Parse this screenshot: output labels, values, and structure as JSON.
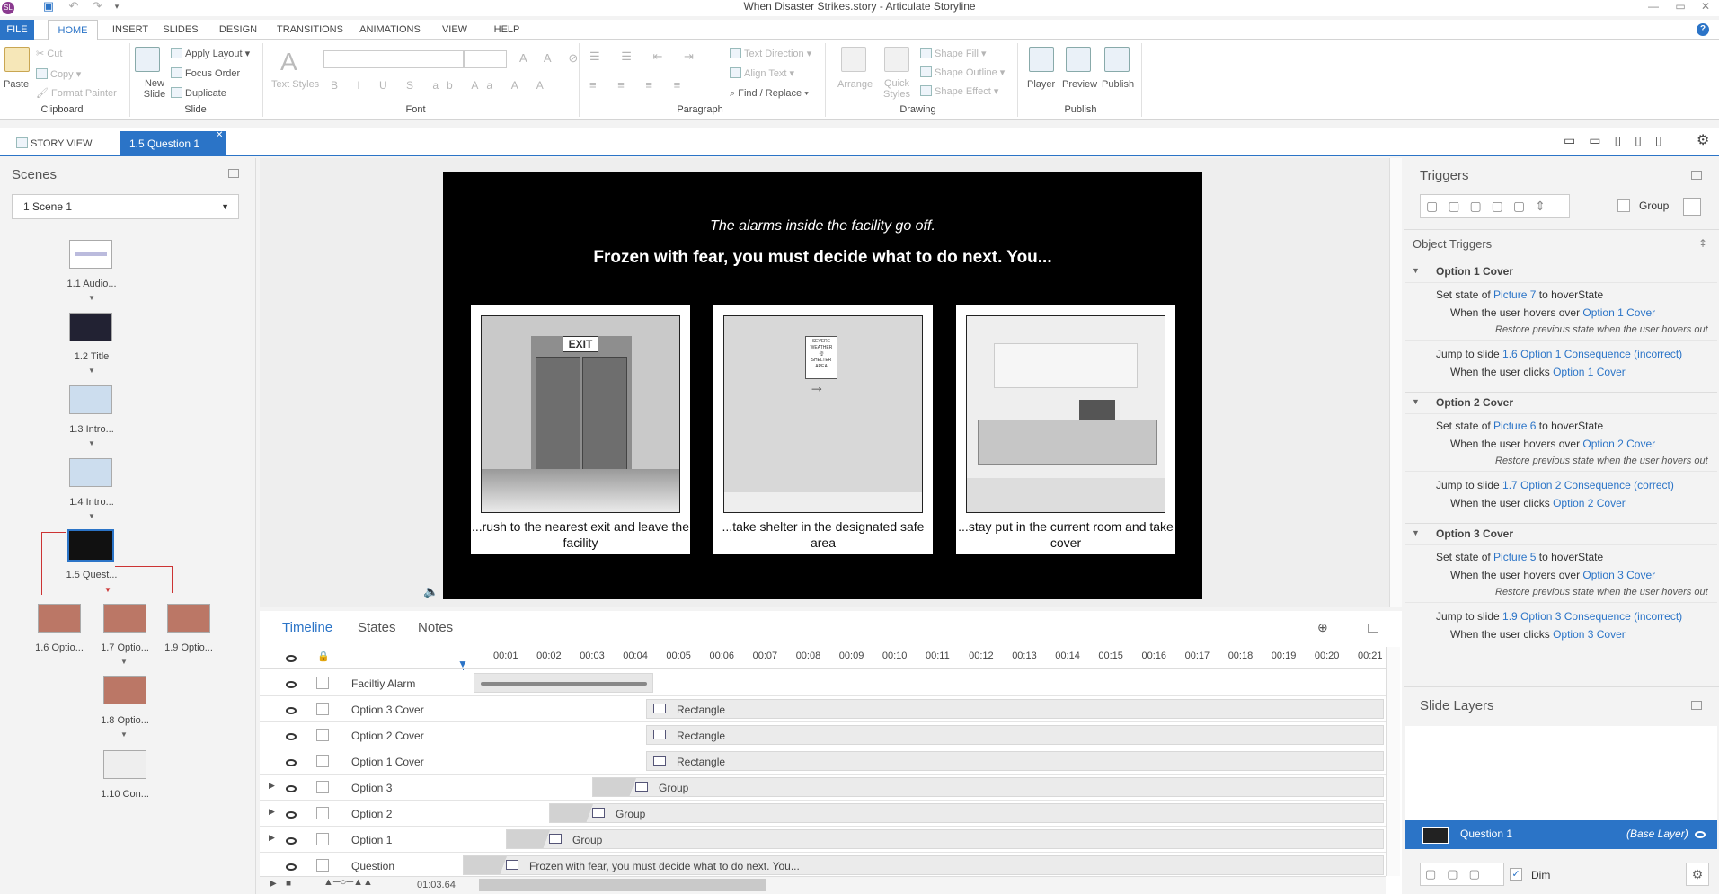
{
  "window": {
    "title": "When Disaster Strikes.story - Articulate Storyline"
  },
  "ribbon_tabs": [
    "FILE",
    "HOME",
    "INSERT",
    "SLIDES",
    "DESIGN",
    "TRANSITIONS",
    "ANIMATIONS",
    "VIEW",
    "HELP"
  ],
  "clipboard": {
    "paste": "Paste",
    "cut": "Cut",
    "copy": "Copy",
    "format_painter": "Format Painter",
    "group": "Clipboard"
  },
  "slide_group": {
    "new_slide": "New Slide",
    "apply_layout": "Apply Layout",
    "focus_order": "Focus Order",
    "duplicate": "Duplicate",
    "group": "Slide"
  },
  "font_group": {
    "text_styles": "Text Styles",
    "group": "Font"
  },
  "paragraph_group": {
    "text_direction": "Text Direction",
    "align_text": "Align Text",
    "find_replace": "Find / Replace",
    "group": "Paragraph"
  },
  "drawing_group": {
    "arrange": "Arrange",
    "quick_styles": "Quick Styles",
    "shape_fill": "Shape Fill",
    "shape_outline": "Shape Outline",
    "shape_effect": "Shape Effect",
    "group": "Drawing"
  },
  "publish_group": {
    "player": "Player",
    "preview": "Preview",
    "publish": "Publish",
    "group": "Publish"
  },
  "doc_tabs": {
    "story_view": "STORY VIEW",
    "active": "1.5 Question 1"
  },
  "scenes": {
    "title": "Scenes",
    "selected": "1 Scene 1",
    "thumbs": [
      "1.1 Audio...",
      "1.2 Title",
      "1.3 Intro...",
      "1.4 Intro...",
      "1.5 Quest...",
      "1.6 Optio...",
      "1.7 Optio...",
      "1.9 Optio...",
      "1.8 Optio...",
      "1.10 Con..."
    ]
  },
  "slide": {
    "subtitle": "The alarms inside the facility go off.",
    "title": "Frozen with fear, you must decide what to do next. You...",
    "options": [
      "...rush to the nearest exit and leave the facility",
      "...take shelter in the designated safe area",
      "...stay put in the current room and take cover"
    ],
    "exit_sign": "EXIT",
    "shelter_sign_top": "SEVERE WEATHER",
    "shelter_sign_bottom": "SHELTER AREA"
  },
  "timeline": {
    "tabs": [
      "Timeline",
      "States",
      "Notes"
    ],
    "ticks": [
      "00:01",
      "00:02",
      "00:03",
      "00:04",
      "00:05",
      "00:06",
      "00:07",
      "00:08",
      "00:09",
      "00:10",
      "00:11",
      "00:12",
      "00:13",
      "00:14",
      "00:15",
      "00:16",
      "00:17",
      "00:18",
      "00:19",
      "00:20",
      "00:21"
    ],
    "rows": [
      {
        "name": "Faciltiy Alarm",
        "bar": ""
      },
      {
        "name": "Option 3 Cover",
        "bar": "Rectangle"
      },
      {
        "name": "Option 2 Cover",
        "bar": "Rectangle"
      },
      {
        "name": "Option 1 Cover",
        "bar": "Rectangle"
      },
      {
        "name": "Option 3",
        "bar": "Group"
      },
      {
        "name": "Option 2",
        "bar": "Group"
      },
      {
        "name": "Option 1",
        "bar": "Group"
      },
      {
        "name": "Question",
        "bar": "Frozen with fear, you must decide what to do next. You..."
      }
    ],
    "duration": "01:03.64"
  },
  "triggers": {
    "title": "Triggers",
    "group_label": "Group",
    "object_triggers": "Object Triggers",
    "sections": [
      {
        "name": "Option 1 Cover",
        "t1_pre": "Set state of",
        "t1_obj": "Picture 7",
        "t1_post": "to hoverState",
        "t1_when": "When the user hovers over",
        "t1_target": "Option 1 Cover",
        "restore": "Restore previous state when the user hovers out",
        "t2_pre": "Jump to slide",
        "t2_obj": "1.6 Option 1 Consequence (incorrect)",
        "t2_when": "When the user clicks",
        "t2_target": "Option 1 Cover"
      },
      {
        "name": "Option 2 Cover",
        "t1_pre": "Set state of",
        "t1_obj": "Picture 6",
        "t1_post": "to hoverState",
        "t1_when": "When the user hovers over",
        "t1_target": "Option 2 Cover",
        "restore": "Restore previous state when the user hovers out",
        "t2_pre": "Jump to slide",
        "t2_obj": "1.7 Option 2 Consequence (correct)",
        "t2_when": "When the user clicks",
        "t2_target": "Option 2 Cover"
      },
      {
        "name": "Option 3 Cover",
        "t1_pre": "Set state of",
        "t1_obj": "Picture 5",
        "t1_post": "to hoverState",
        "t1_when": "When the user hovers over",
        "t1_target": "Option 3 Cover",
        "restore": "Restore previous state when the user hovers out",
        "t2_pre": "Jump to slide",
        "t2_obj": "1.9 Option 3 Consequence (incorrect)",
        "t2_when": "When the user clicks",
        "t2_target": "Option 3 Cover"
      }
    ]
  },
  "slide_layers": {
    "title": "Slide Layers",
    "layer": "Question 1",
    "base": "(Base Layer)",
    "dim": "Dim"
  },
  "colors": {
    "accent": "#2b74c7"
  }
}
